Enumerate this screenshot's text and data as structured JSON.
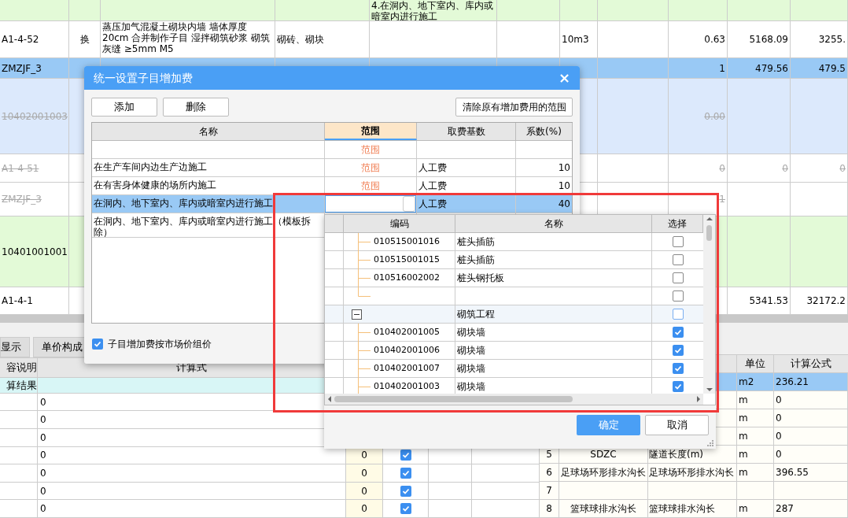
{
  "sheet": {
    "rows": [
      {
        "color": "#e3fad7",
        "struck": false,
        "column_5": "4.在洞内、地下室内、库内或暗室内进行施工"
      },
      {
        "color": "#ffffff",
        "struck": false,
        "column_1": "A1-4-52",
        "column_2": "换",
        "column_3": "蒸压加气混凝土砌块内墙 墙体厚度 20cm 合并制作子目 湿拌砌筑砂浆 砌筑灰缝 ≥5mm M5",
        "column_4": "砌砖、砌块",
        "column_7": "10m3",
        "column_9": "0.63",
        "column_10": "5168.09",
        "column_11": "3255."
      },
      {
        "color": "#99c9f5",
        "struck": false,
        "column_1": "ZMZJF_3",
        "column_9": "1",
        "column_10": "479.56",
        "column_11": "479.5"
      },
      {
        "color": "#dce9fc",
        "struck": true,
        "column_1": "10402001003",
        "column_9": "0.00"
      },
      {
        "color": "#ffffff",
        "struck": true,
        "column_1": "A1-4-51",
        "column_9": "0",
        "column_10": "0",
        "column_11": "0"
      },
      {
        "color": "#ffffff",
        "struck": true,
        "column_1": "ZMZJF_3",
        "column_9": "1"
      },
      {
        "color": "#e3fad7",
        "struck": false,
        "column_1": "10401001001"
      },
      {
        "color": "#ffffff",
        "struck": false,
        "column_1": "A1-4-1",
        "column_10": "5341.53",
        "column_11": "32172.2"
      }
    ]
  },
  "bottom_tabs": [
    {
      "label": "显示",
      "selected": false
    },
    {
      "label": "单价构成",
      "selected": false
    }
  ],
  "detail_table": {
    "columns": [
      "容说明",
      "计算式"
    ],
    "rows": [
      {
        "kind": "result",
        "label": "算结果"
      },
      {
        "kind": "item",
        "formula": "0"
      },
      {
        "kind": "item",
        "formula": "0"
      },
      {
        "kind": "item",
        "formula": "0"
      },
      {
        "kind": "item",
        "formula": "0",
        "value": "0",
        "checked": true
      },
      {
        "kind": "item",
        "formula": "0",
        "value": "0",
        "checked": true
      },
      {
        "kind": "item",
        "formula": "0",
        "value": "0",
        "checked": true
      },
      {
        "kind": "item",
        "formula": "0",
        "value": "0",
        "checked": true
      }
    ]
  },
  "quantity_table": {
    "columns": [
      "单位",
      "计算公式"
    ],
    "rows": [
      {
        "unit": "m2",
        "formula": "236.21",
        "selected": true
      },
      {
        "unit": "m",
        "formula": "0",
        "selected": false
      },
      {
        "unit": "m",
        "formula": "0",
        "selected": false
      },
      {
        "unit": "m",
        "formula": "0",
        "selected": false
      },
      {
        "no": "5",
        "code": "SDZC",
        "name": "隧道长度(m)",
        "unit": "m",
        "formula": "0",
        "selected": false
      },
      {
        "no": "6",
        "code": "足球场环形排水沟长",
        "name": "足球场环形排水沟长",
        "unit": "m",
        "formula": "396.55",
        "selected": false
      },
      {
        "no": "7",
        "selected": false
      },
      {
        "no": "8",
        "code": "篮球球排水沟长",
        "name": "篮球球排水沟长",
        "unit": "m",
        "formula": "287",
        "selected": false
      }
    ]
  },
  "dialog": {
    "title": "统一设置子目增加费",
    "close": "×",
    "buttons": [
      "添加",
      "删除"
    ],
    "clear_button": "清除原有增加费用的范围",
    "table": {
      "columns": [
        {
          "label": "名称",
          "selected": false
        },
        {
          "label": "范围",
          "selected": true
        },
        {
          "label": "取费基数",
          "selected": false
        },
        {
          "label": "系数(%)",
          "selected": false
        }
      ],
      "rows": [
        {
          "kind": "row",
          "scope": "范围",
          "selected": false
        },
        {
          "kind": "row",
          "name": "在生产车间内边生产边施工",
          "scope": "范围",
          "base": "人工费",
          "factor": "10",
          "selected": false
        },
        {
          "kind": "row",
          "name": "在有害身体健康的场所内施工",
          "scope": "范围",
          "base": "人工费",
          "factor": "10",
          "selected": false
        },
        {
          "kind": "editing",
          "name": "在洞内、地下室内、库内或暗室内进行施工",
          "base": "人工费",
          "factor": "40",
          "selected": true
        },
        {
          "kind": "row",
          "name": "在洞内、地下室内、库内或暗室内进行施工（模板拆除）",
          "selected": false
        }
      ]
    },
    "option": {
      "label": "子目增加费按市场价组价",
      "checked": true
    }
  },
  "picker": {
    "columns": [
      "编码",
      "名称",
      "选择"
    ],
    "rows": [
      {
        "kind": "leaf",
        "code": "010515001016",
        "name": "桩头插筋",
        "checked": false
      },
      {
        "kind": "leaf",
        "code": "010515001015",
        "name": "桩头插筋",
        "checked": false
      },
      {
        "kind": "leaf",
        "code": "010516002002",
        "name": "桩头钢托板",
        "checked": false
      },
      {
        "kind": "end",
        "checked": false
      },
      {
        "kind": "group",
        "name": "砌筑工程",
        "expanded": true,
        "checked": false
      },
      {
        "kind": "leaf",
        "code": "010402001005",
        "name": "砌块墙",
        "checked": true
      },
      {
        "kind": "leaf",
        "code": "010402001006",
        "name": "砌块墙",
        "checked": true
      },
      {
        "kind": "leaf",
        "code": "010402001007",
        "name": "砌块墙",
        "checked": true
      },
      {
        "kind": "leaf",
        "code": "010402001003",
        "name": "砌块墙",
        "checked": true
      }
    ],
    "buttons": [
      {
        "label": "确定",
        "kind": "primary"
      },
      {
        "label": "取消",
        "kind": "normal"
      }
    ]
  }
}
